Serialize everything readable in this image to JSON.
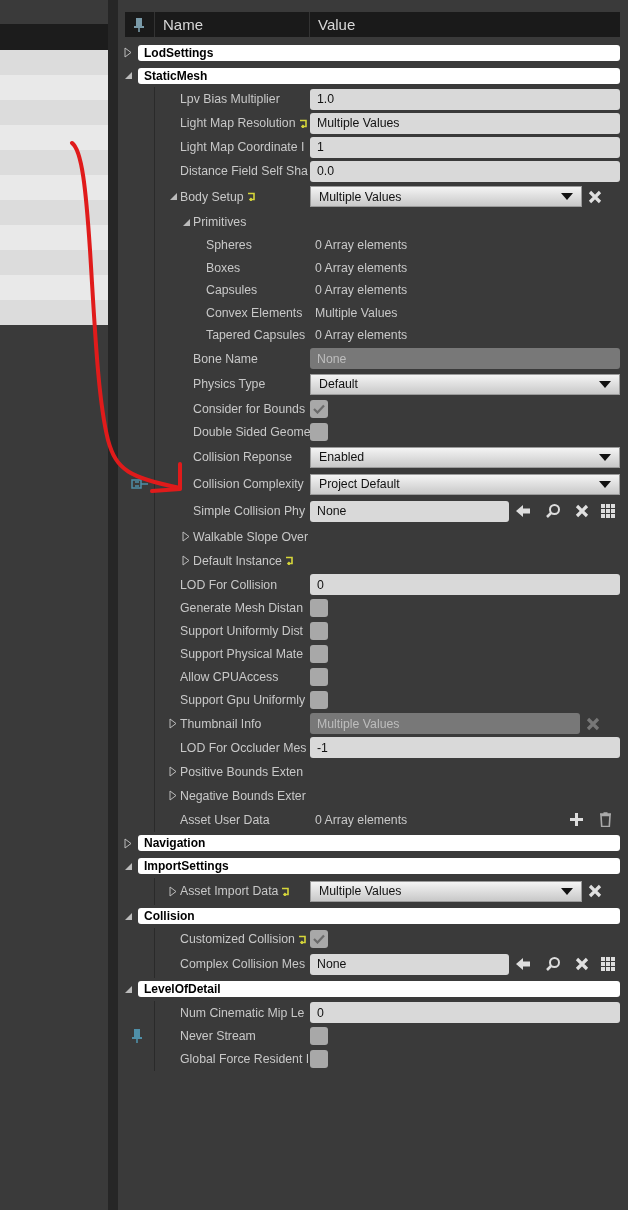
{
  "header": {
    "columns": [
      "Name",
      "Value"
    ]
  },
  "sections": [
    {
      "title": "LodSettings",
      "expanded": false
    },
    {
      "title": "StaticMesh",
      "expanded": true,
      "rows": [
        {
          "kind": "text",
          "label": "Lpv Bias Multiplier",
          "value": "1.0"
        },
        {
          "kind": "text",
          "label": "Light Map Resolution",
          "value": "Multiple Values",
          "reset": true
        },
        {
          "kind": "text",
          "label": "Light Map Coordinate I",
          "value": "1"
        },
        {
          "kind": "text",
          "label": "Distance Field Self Sha",
          "value": "0.0"
        },
        {
          "kind": "dropdown",
          "label": "Body Setup",
          "value": "Multiple Values",
          "reset": true,
          "clearable": true,
          "expanded": true,
          "children": [
            {
              "kind": "group",
              "label": "Primitives",
              "expanded": true,
              "children": [
                {
                  "kind": "array",
                  "label": "Spheres",
                  "value": "0 Array elements"
                },
                {
                  "kind": "array",
                  "label": "Boxes",
                  "value": "0 Array elements"
                },
                {
                  "kind": "array",
                  "label": "Capsules",
                  "value": "0 Array elements"
                },
                {
                  "kind": "array",
                  "label": "Convex Elements",
                  "value": "Multiple Values"
                },
                {
                  "kind": "array",
                  "label": "Tapered Capsules",
                  "value": "0 Array elements"
                }
              ]
            },
            {
              "kind": "text",
              "label": "Bone Name",
              "value": "None",
              "disabled": true
            },
            {
              "kind": "dropdown",
              "label": "Physics Type",
              "value": "Default"
            },
            {
              "kind": "checkbox",
              "label": "Consider for Bounds",
              "checked": true
            },
            {
              "kind": "checkbox",
              "label": "Double Sided Geome",
              "checked": false
            },
            {
              "kind": "dropdown",
              "label": "Collision Reponse",
              "value": "Enabled"
            },
            {
              "kind": "dropdown",
              "label": "Collision Complexity",
              "value": "Project Default",
              "linked": true
            },
            {
              "kind": "asset",
              "label": "Simple Collision Phy",
              "value": "None"
            },
            {
              "kind": "group",
              "label": "Walkable Slope Over",
              "expanded": false
            },
            {
              "kind": "group",
              "label": "Default Instance",
              "expanded": false,
              "reset": true
            }
          ]
        },
        {
          "kind": "text",
          "label": "LOD For Collision",
          "value": "0"
        },
        {
          "kind": "checkbox",
          "label": "Generate Mesh Distan",
          "checked": false
        },
        {
          "kind": "checkbox",
          "label": "Support Uniformly Dist",
          "checked": false
        },
        {
          "kind": "checkbox",
          "label": "Support Physical Mate",
          "checked": false
        },
        {
          "kind": "checkbox",
          "label": "Allow CPUAccess",
          "checked": false
        },
        {
          "kind": "checkbox",
          "label": "Support Gpu Uniformly",
          "checked": false
        },
        {
          "kind": "text",
          "label": "Thumbnail Info",
          "value": "Multiple Values",
          "disabled": true,
          "clearable": true,
          "expanded": false
        },
        {
          "kind": "text",
          "label": "LOD For Occluder Mes",
          "value": "-1"
        },
        {
          "kind": "group",
          "label": "Positive Bounds Exten",
          "expanded": false
        },
        {
          "kind": "group",
          "label": "Negative Bounds Exter",
          "expanded": false
        },
        {
          "kind": "array_edit",
          "label": "Asset User Data",
          "value": "0 Array elements"
        }
      ]
    },
    {
      "title": "Navigation",
      "expanded": false
    },
    {
      "title": "ImportSettings",
      "expanded": true,
      "rows": [
        {
          "kind": "dropdown",
          "label": "Asset Import Data",
          "value": "Multiple Values",
          "reset": true,
          "clearable": true,
          "expanded": false
        }
      ]
    },
    {
      "title": "Collision",
      "expanded": true,
      "rows": [
        {
          "kind": "checkbox",
          "label": "Customized Collision",
          "checked": true,
          "reset": true
        },
        {
          "kind": "asset",
          "label": "Complex Collision Mes",
          "value": "None"
        }
      ]
    },
    {
      "title": "LevelOfDetail",
      "expanded": true,
      "rows": [
        {
          "kind": "text",
          "label": "Num Cinematic Mip Le",
          "value": "0"
        },
        {
          "kind": "checkbox",
          "label": "Never Stream",
          "checked": false,
          "pinned": true
        },
        {
          "kind": "checkbox",
          "label": "Global Force Resident I",
          "checked": false
        }
      ]
    }
  ]
}
